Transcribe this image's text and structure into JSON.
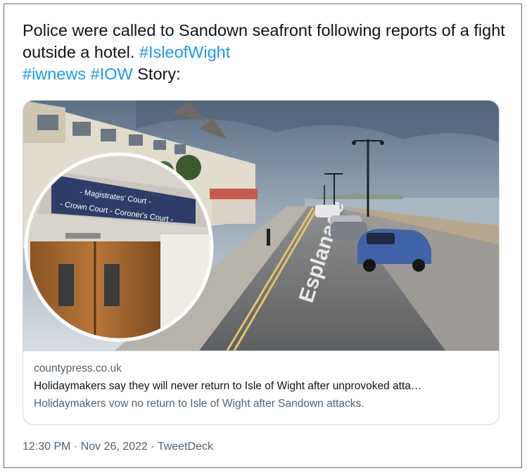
{
  "tweet": {
    "text_before": "Police were called to Sandown seafront following reports of a fight outside a hotel. ",
    "hashtags": [
      "#IsleofWight",
      "#iwnews",
      "#IOW"
    ],
    "text_after": " Story:"
  },
  "card": {
    "domain": "countypress.co.uk",
    "headline": "Holidaymakers say they will never return to Isle of Wight after unprovoked atta…",
    "description": "Holidaymakers vow no return to Isle of Wight after Sandown attacks.",
    "image": {
      "sign_line1": "- Magistrates' Court -",
      "sign_line2": "- Crown Court - Coroner's Court -",
      "road_marking": "Esplanade"
    }
  },
  "meta": {
    "time": "12:30 PM",
    "separator": " · ",
    "date": "Nov 26, 2022",
    "source": "TweetDeck"
  },
  "colors": {
    "link": "#1d9bf0",
    "text": "#0f1419",
    "secondary": "#536471",
    "border": "#cfd9de"
  }
}
